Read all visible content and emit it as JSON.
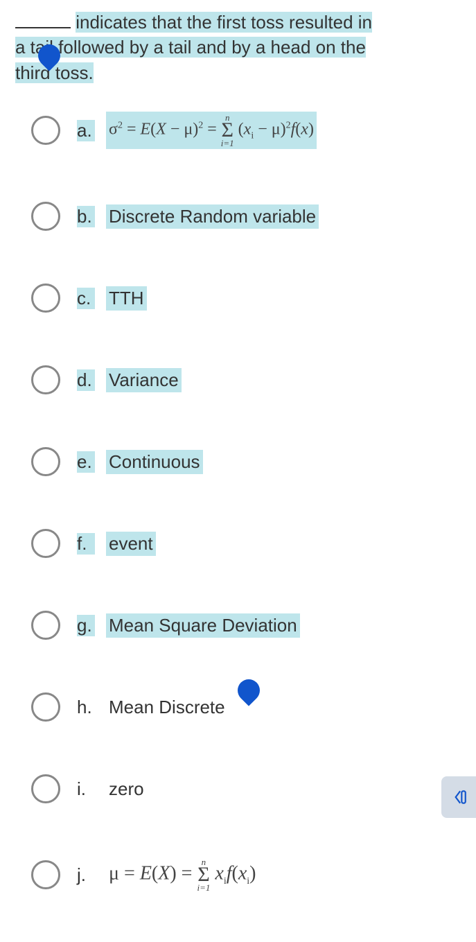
{
  "question": {
    "prefix": "______ ",
    "part1": "indicates that the first toss resulted in",
    "part2": "a tail followed by a tail and by a head on the",
    "part3": "third toss."
  },
  "options": {
    "a": {
      "letter": "a.",
      "is_formula": true
    },
    "b": {
      "letter": "b.",
      "text": "Discrete Random variable"
    },
    "c": {
      "letter": "c.",
      "text": "TTH"
    },
    "d": {
      "letter": "d.",
      "text": "Variance"
    },
    "e": {
      "letter": "e.",
      "text": "Continuous"
    },
    "f": {
      "letter": "f.",
      "text": "event"
    },
    "g": {
      "letter": "g.",
      "text": "Mean Square Deviation"
    },
    "h": {
      "letter": "h.",
      "text": "Mean Discrete"
    },
    "i": {
      "letter": "i.",
      "text": "zero"
    },
    "j": {
      "letter": "j.",
      "is_formula": true
    }
  },
  "formula_a": "σ² = E(X − μ)² = Σ (xᵢ − μ)² f(x)",
  "formula_j": "μ = E(X) = Σ xᵢ f(xᵢ)"
}
